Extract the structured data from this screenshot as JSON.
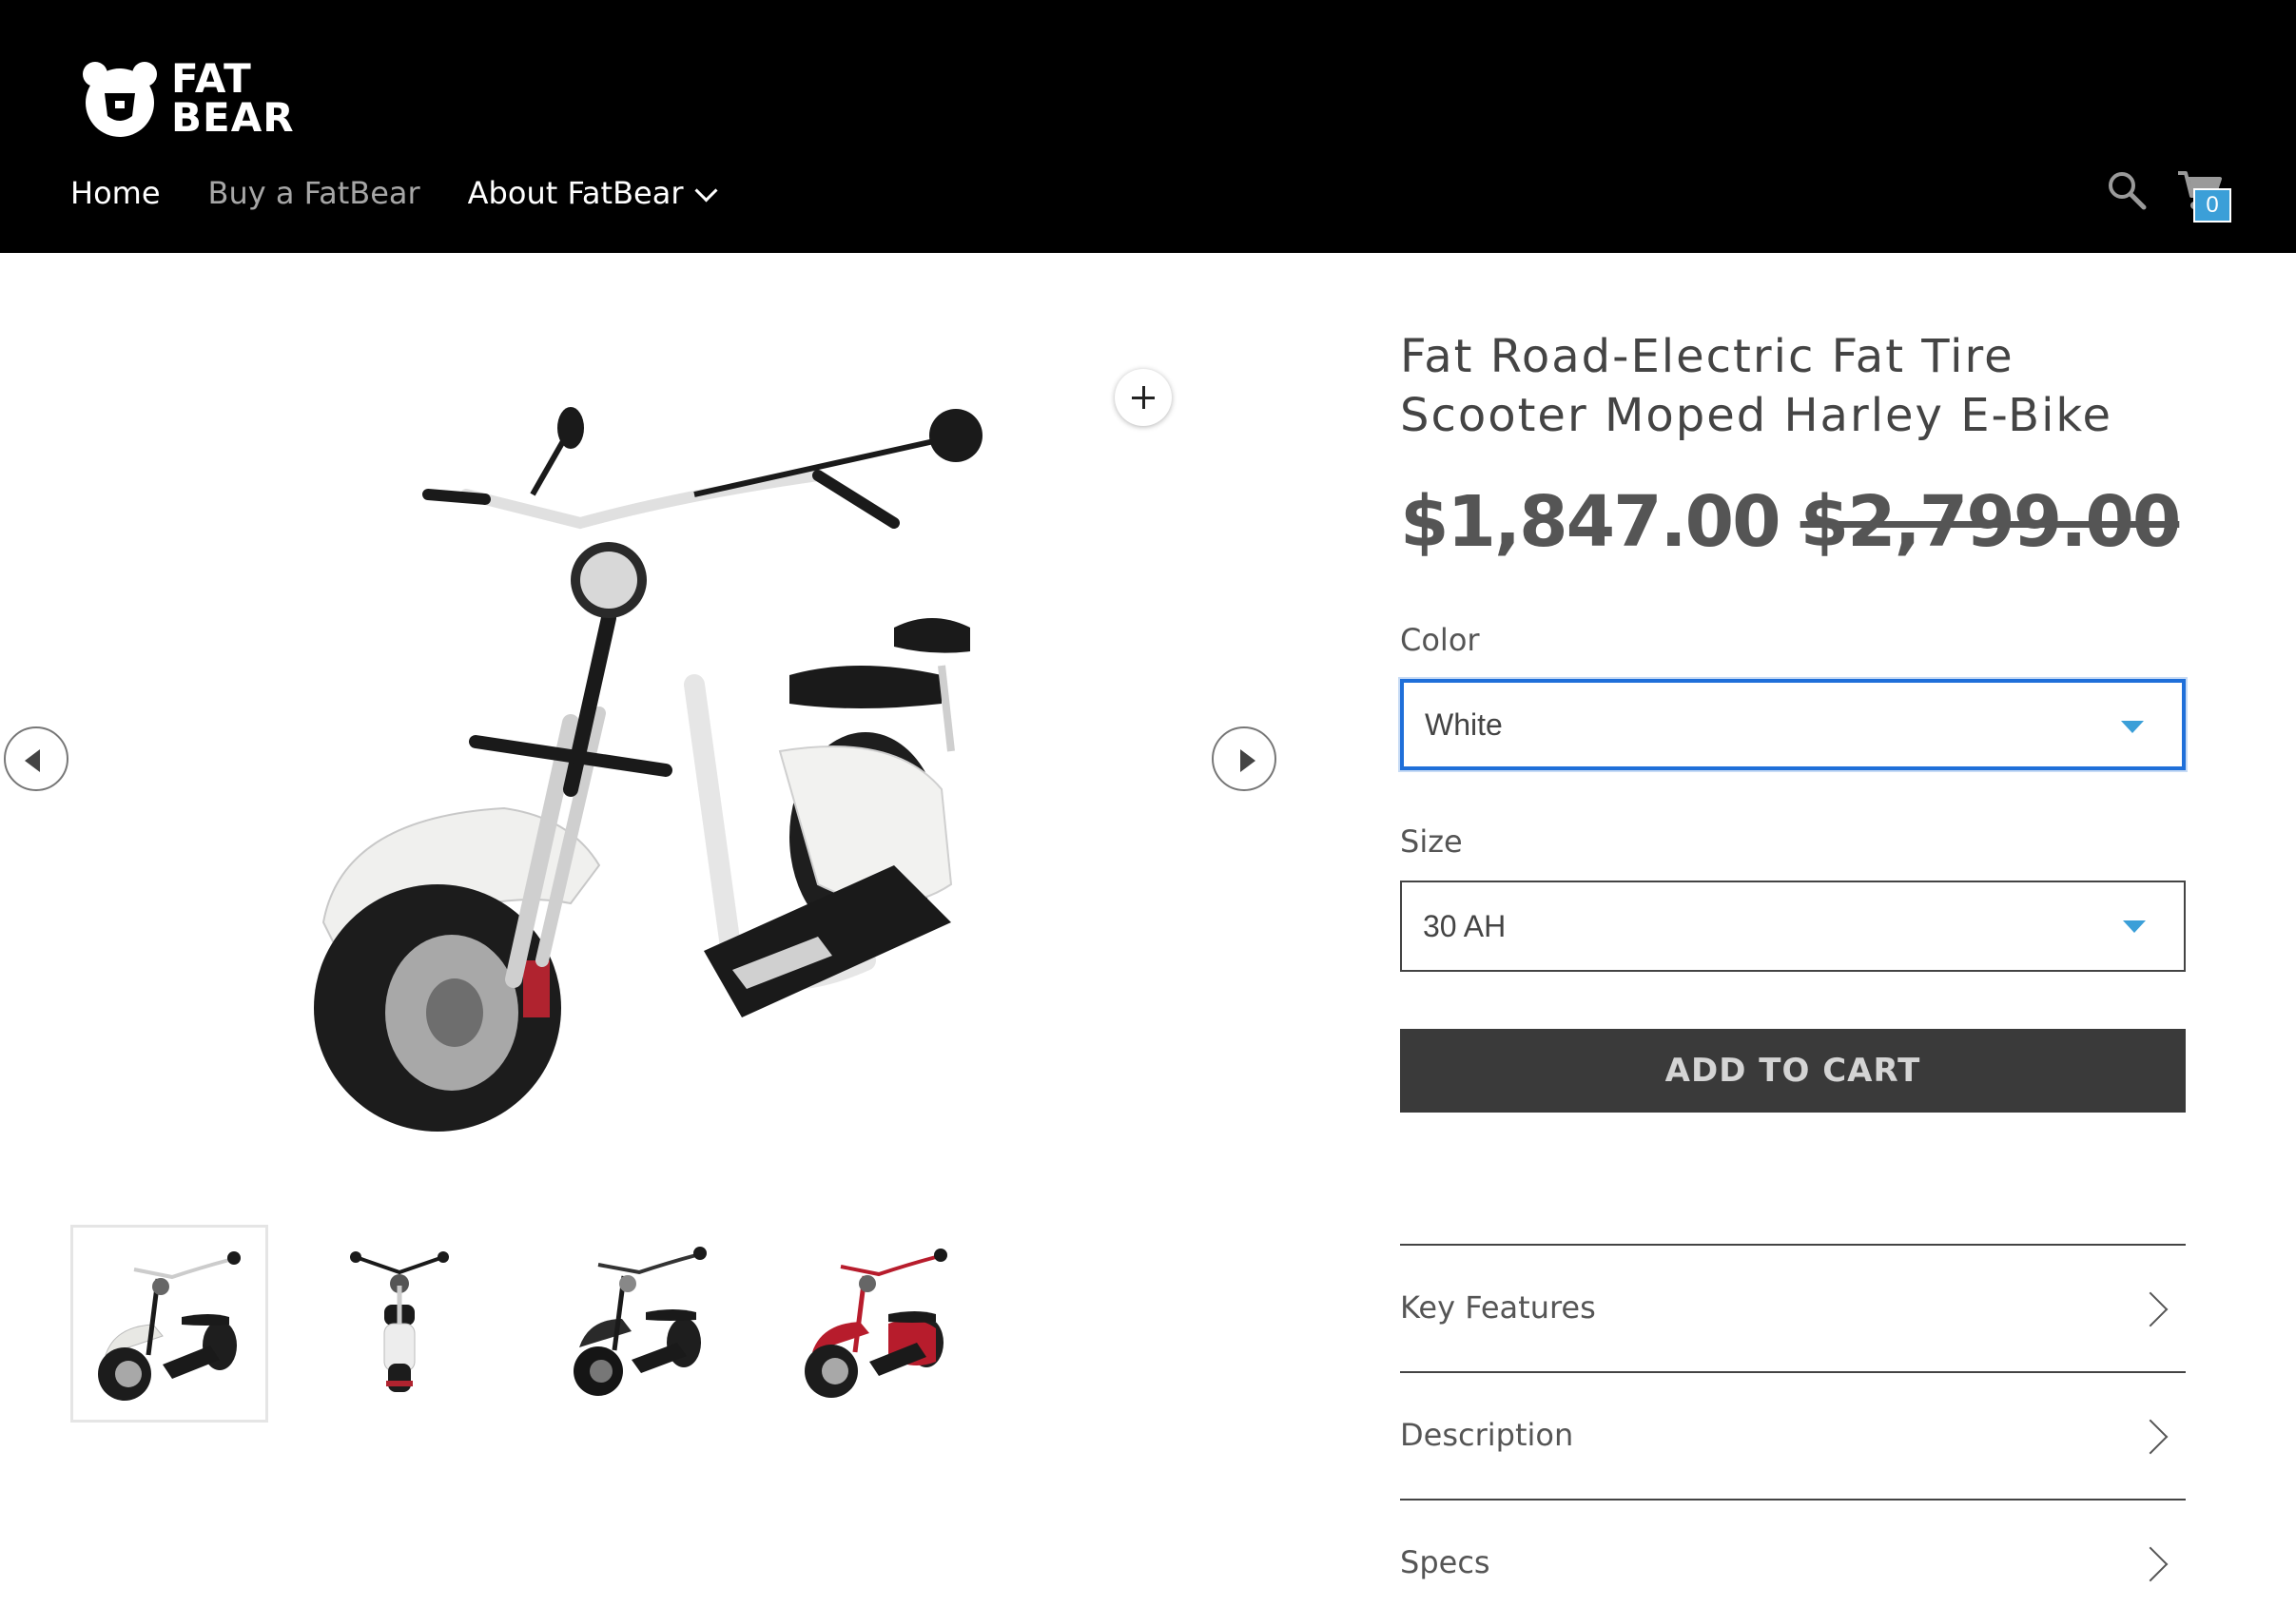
{
  "header": {
    "logo_line1": "FAT",
    "logo_line2": "BEAR",
    "nav": [
      {
        "label": "Home"
      },
      {
        "label": "Buy a FatBear"
      },
      {
        "label": "About FatBear"
      }
    ],
    "search_icon": "search-icon",
    "cart_icon": "cart-icon",
    "cart_count": "0"
  },
  "gallery": {
    "zoom_icon": "plus-icon",
    "prev_icon": "left-arrow-icon",
    "next_icon": "right-arrow-icon",
    "thumbnails": [
      {
        "color": "#e8e8e4",
        "active": true
      },
      {
        "color": "#ededed",
        "active": false,
        "view": "front"
      },
      {
        "color": "#2a2a2a",
        "active": false
      },
      {
        "color": "#b71c2c",
        "active": false
      }
    ]
  },
  "product": {
    "title": "Fat Road-Electric Fat Tire Scooter Moped Harley E-Bike",
    "price": "$1,847.00",
    "compare_price": "$2,799.00",
    "color_label": "Color",
    "color_value": "White",
    "size_label": "Size",
    "size_value": "30 AH",
    "add_to_cart": "ADD TO CART",
    "accordion": [
      {
        "label": "Key Features"
      },
      {
        "label": "Description"
      },
      {
        "label": "Specs"
      }
    ]
  },
  "colors": {
    "header_bg": "#000000",
    "select_focus": "#1f6fd9",
    "caret": "#3b9fd8",
    "cart_badge": "#3b9fd8",
    "button_bg": "#3a3a3a"
  }
}
